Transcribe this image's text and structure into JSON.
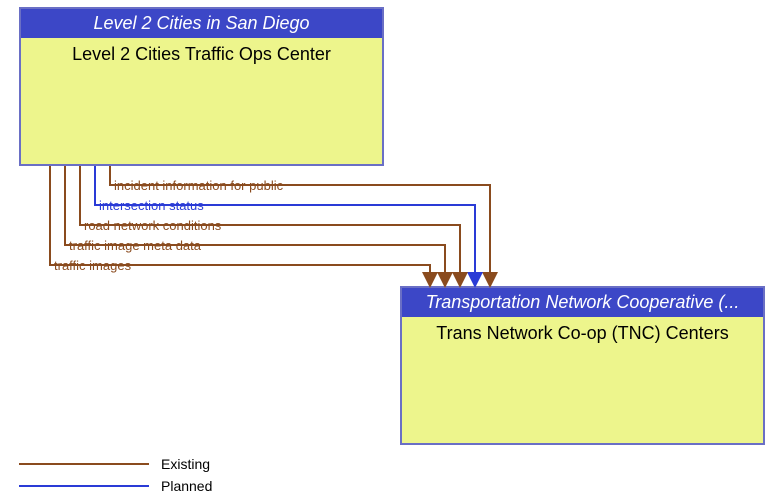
{
  "nodes": {
    "left": {
      "header": "Level 2 Cities in San Diego",
      "title": "Level 2 Cities Traffic Ops Center"
    },
    "right": {
      "header": "Transportation Network Cooperative (...",
      "title": "Trans Network Co-op (TNC) Centers"
    }
  },
  "flows": [
    {
      "label": "incident information for public",
      "status": "existing"
    },
    {
      "label": "intersection status",
      "status": "planned"
    },
    {
      "label": "road network conditions",
      "status": "existing"
    },
    {
      "label": "traffic image meta data",
      "status": "existing"
    },
    {
      "label": "traffic images",
      "status": "existing"
    }
  ],
  "legend": {
    "existing": "Existing",
    "planned": "Planned"
  },
  "colors": {
    "existing": "#8a4b1e",
    "planned": "#2a3bd6",
    "node_header_bg": "#3c47c7",
    "node_body_bg": "#edf58c",
    "node_border": "#6a6fc5"
  }
}
